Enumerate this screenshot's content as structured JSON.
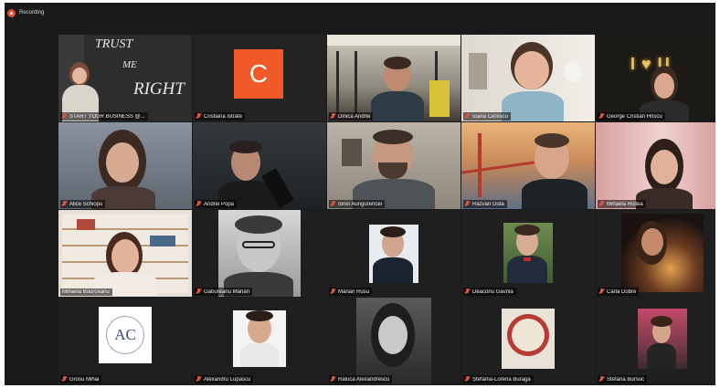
{
  "app": {
    "recording_label": "Recording",
    "colors": {
      "recording": "#e34b3d",
      "active_speaker": "#b9d35a",
      "muted_mic": "#e0533f"
    }
  },
  "tiles": [
    {
      "name": "START YOUR BUSINESS @...",
      "wall_lines": [
        "TRUST",
        "ME",
        "RIGHT"
      ]
    },
    {
      "name": "Cristiana Istrate",
      "avatar_letter": "C"
    },
    {
      "name": "Dinica Andrei"
    },
    {
      "name": "Ioana Cerescu"
    },
    {
      "name": "George Cristian Hriscu",
      "neon_text": "I ♥ U"
    },
    {
      "name": "Alice Schiopu"
    },
    {
      "name": "Andrei Popa"
    },
    {
      "name": "Ionel Aungurencei"
    },
    {
      "name": "Razvan Duta"
    },
    {
      "name": "Mihaela Ristea"
    },
    {
      "name": "Mihaela Bourceanu"
    },
    {
      "name": "Gabureanu Marian"
    },
    {
      "name": "Marian Rusu"
    },
    {
      "name": "Deaconu Gavrila"
    },
    {
      "name": "Carla Dobre"
    },
    {
      "name": "Grosu Mihai",
      "logo_text": "AC"
    },
    {
      "name": "Alexandru Lupașcu"
    },
    {
      "name": "Raluca Alexandrescu"
    },
    {
      "name": "Ștefania-Lorena Buraga"
    },
    {
      "name": "Stefana Bursuc"
    }
  ]
}
